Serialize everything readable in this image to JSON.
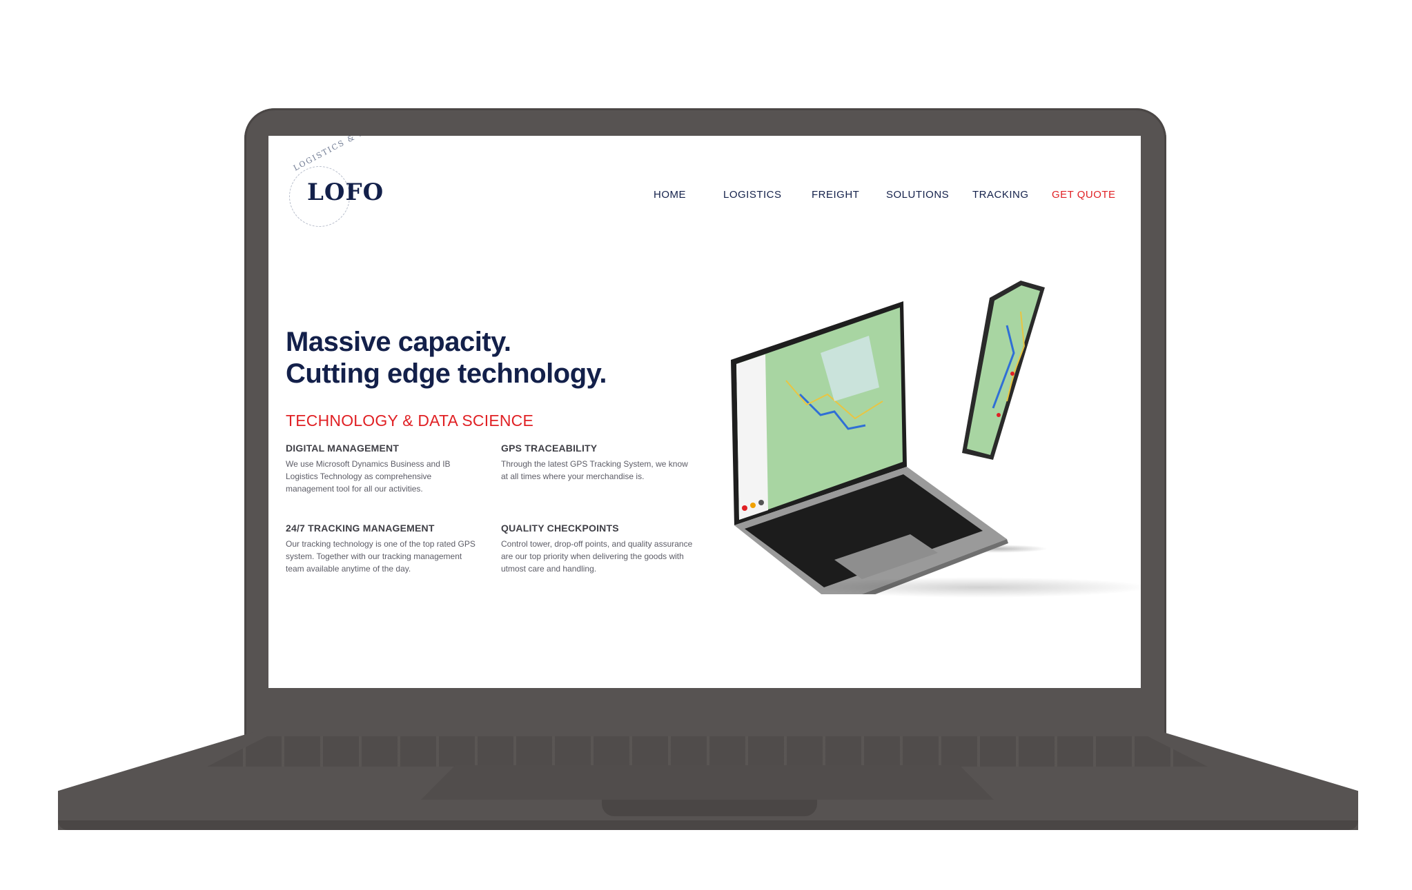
{
  "logo": {
    "word": "LOFO",
    "ring_text": "LOGISTICS & FORWARDING",
    "ring_text_fragment": "& FORW"
  },
  "nav": {
    "items": [
      {
        "label": "HOME"
      },
      {
        "label": "LOGISTICS"
      },
      {
        "label": "FREIGHT"
      },
      {
        "label": "SOLUTIONS"
      },
      {
        "label": "TRACKING"
      }
    ],
    "cta": "GET QUOTE"
  },
  "hero": {
    "headline_line1": "Massive capacity.",
    "headline_line2": "Cutting edge technology.",
    "subhead": "TECHNOLOGY & DATA SCIENCE"
  },
  "features": [
    {
      "title": "DIGITAL MANAGEMENT",
      "text": "We use Microsoft Dynamics Business and IB Logistics Technology as comprehensive management tool for all our activities."
    },
    {
      "title": "GPS TRACEABILITY",
      "text": "Through the latest GPS Tracking System, we know at all times where your merchandise is."
    },
    {
      "title": "24/7 TRACKING MANAGEMENT",
      "text": "Our tracking technology is one of the top rated GPS system. Together with our tracking management team available anytime of the day."
    },
    {
      "title": "QUALITY CHECKPOINTS",
      "text": "Control tower, drop-off points, and quality assurance are our top priority when delivering the goods with utmost care and handling."
    }
  ],
  "colors": {
    "navy": "#13204a",
    "red": "#e02024",
    "mockup_gray": "#575352",
    "map_green": "#a8d5a2"
  },
  "illustration": {
    "laptop": "laptop-map-mockup",
    "phone": "phone-map-mockup"
  }
}
